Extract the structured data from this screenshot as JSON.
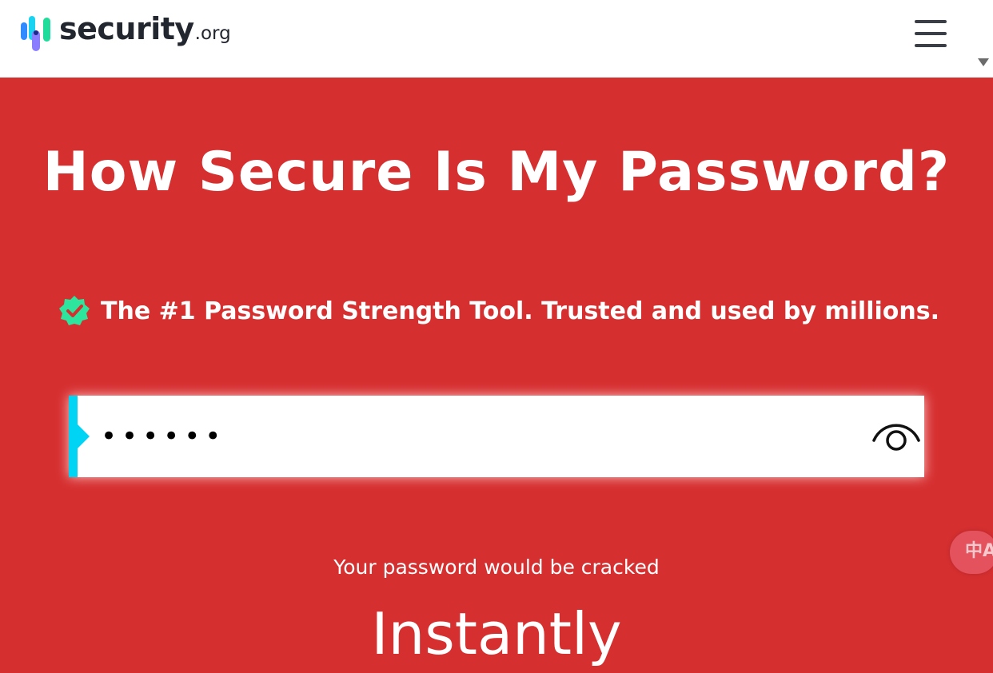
{
  "brand": {
    "name": "security",
    "tld": ".org",
    "colors": {
      "bar_blue": "#2f8bff",
      "bar_cyan": "#19d3f0",
      "bar_green": "#1fdc9a",
      "bar_purple": "#8a7dff"
    }
  },
  "header": {
    "menu_icon": "hamburger-menu-icon"
  },
  "hero": {
    "title": "How Secure Is My Password?",
    "tagline": "The #1 Password Strength Tool. Trusted and used by millions.",
    "tagline_icon": "verified-check-badge-icon",
    "background": "#d62f30",
    "badge_color": "#2ee59d"
  },
  "password_field": {
    "value": "••••••",
    "accent_color": "#00d4f4",
    "toggle_icon": "eye-visibility-icon"
  },
  "result": {
    "label": "Your password would be cracked",
    "time": "Instantly"
  },
  "widgets": {
    "translate_icon": "translate-icon",
    "translate_glyph": "中A",
    "scroll_icon": "scroll-down-arrow-icon"
  }
}
